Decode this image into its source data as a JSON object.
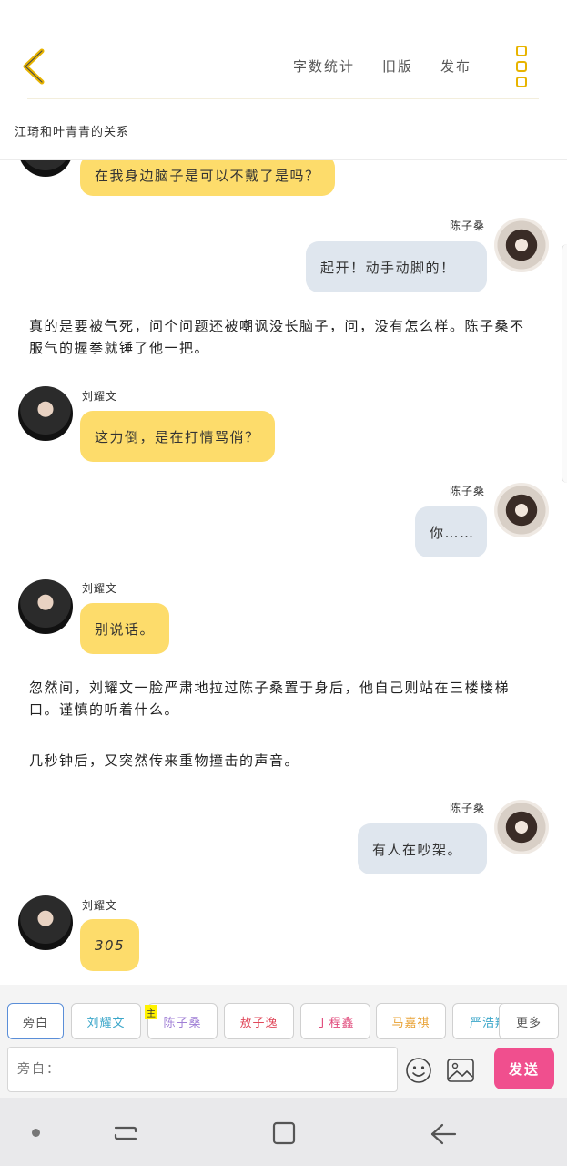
{
  "toolbar": {
    "word_count": "字数统计",
    "old_version": "旧版",
    "publish": "发布"
  },
  "story": {
    "title": "江琦和叶青青的关系"
  },
  "messages": {
    "m1": {
      "text": "在我身边脑子是可以不戴了是吗？"
    },
    "m2": {
      "name": "陈子桑",
      "text": "起开！动手动脚的！"
    },
    "n1": {
      "text": "真的是要被气死，问个问题还被嘲讽没长脑子，问，没有怎么样。陈子桑不服气的握拳就锤了他一把。"
    },
    "m3": {
      "name": "刘耀文",
      "text": "这力倒，是在打情骂俏？"
    },
    "m4": {
      "name": "陈子桑",
      "text": "你……"
    },
    "m5": {
      "name": "刘耀文",
      "text": "别说话。"
    },
    "n2": {
      "text": "忽然间，刘耀文一脸严肃地拉过陈子桑置于身后，他自己则站在三楼楼梯口。谨慎的听着什么。"
    },
    "n3": {
      "text": "几秒钟后，又突然传来重物撞击的声音。"
    },
    "m6": {
      "name": "陈子桑",
      "text": "有人在吵架。"
    },
    "m7": {
      "name": "刘耀文",
      "text": "305"
    }
  },
  "characters": {
    "narrator": {
      "label": "旁白",
      "color": "#555555"
    },
    "liu": {
      "label": "刘耀文",
      "color": "#3aa6c9"
    },
    "chen": {
      "label": "陈子桑",
      "color": "#a07fd6"
    },
    "ao": {
      "label": "敖子逸",
      "color": "#e0485a"
    },
    "ding": {
      "label": "丁程鑫",
      "color": "#e0487a"
    },
    "ma": {
      "label": "马嘉祺",
      "color": "#e8a030"
    },
    "yan": {
      "label": "严浩翔",
      "color": "#3aa6c9"
    },
    "main_badge": "主",
    "more": "更多"
  },
  "composer": {
    "placeholder": "旁白：",
    "send": "发送"
  }
}
